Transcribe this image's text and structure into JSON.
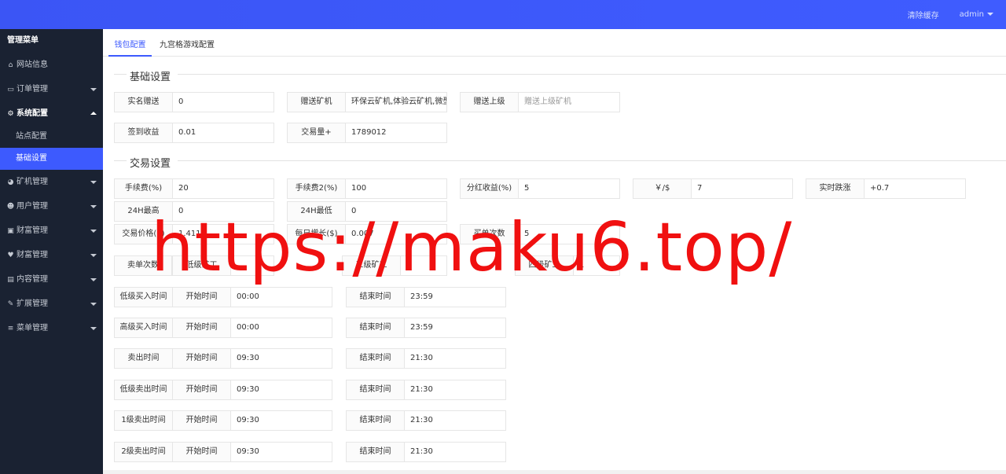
{
  "topbar": {
    "clear_cache": "清除缓存",
    "user": "admin"
  },
  "sidebar": {
    "title": "管理菜单",
    "items": [
      {
        "label": "网站信息",
        "icon": "home-icon"
      },
      {
        "label": "订单管理",
        "icon": "card-icon"
      },
      {
        "label": "系统配置",
        "icon": "gears-icon"
      },
      {
        "label": "矿机管理",
        "icon": "pie-icon"
      },
      {
        "label": "用户管理",
        "icon": "users-icon"
      },
      {
        "label": "财富管理",
        "icon": "money-icon"
      },
      {
        "label": "财富管理",
        "icon": "heartbeat-icon"
      },
      {
        "label": "内容管理",
        "icon": "file-icon"
      },
      {
        "label": "扩展管理",
        "icon": "wrench-icon"
      },
      {
        "label": "菜单管理",
        "icon": "bars-icon"
      }
    ],
    "sub_items": [
      "站点配置",
      "基础设置"
    ]
  },
  "tabs": [
    "钱包配置",
    "九宫格游戏配置"
  ],
  "sections": {
    "basic": "基础设置",
    "trade": "交易设置"
  },
  "basic": {
    "real_name_gift": {
      "label": "实名赠送",
      "value": "0"
    },
    "gift_miner": {
      "label": "赠送矿机",
      "value": "环保云矿机,体验云矿机,微型云矿机"
    },
    "gift_superior": {
      "label": "赠送上级",
      "placeholder": "赠送上级矿机"
    },
    "signin_income": {
      "label": "签到收益",
      "value": "0.01"
    },
    "trade_volume": {
      "label": "交易量+",
      "value": "1789012"
    }
  },
  "trade": {
    "fee": {
      "label": "手续费(%)",
      "value": "20"
    },
    "fee2": {
      "label": "手续费2(%)",
      "value": "100"
    },
    "dividend": {
      "label": "分红收益(%)",
      "value": "5"
    },
    "rate": {
      "label": "￥/$",
      "value": "7"
    },
    "realtime": {
      "label": "实时跌涨",
      "value": "+0.7"
    },
    "high24": {
      "label": "24H最高",
      "value": "0"
    },
    "low24": {
      "label": "24H最低",
      "value": "0"
    },
    "price": {
      "label": "交易价格($)",
      "value": "1.411"
    },
    "daily_growth": {
      "label": "每日增长($)",
      "value": "0.007"
    },
    "buy_times": {
      "label": "买单次数",
      "value": "5"
    },
    "sell_times": {
      "label": "卖单次数",
      "value": ""
    },
    "low_worker": {
      "label": "低级矿工",
      "value": ""
    },
    "third_worker": {
      "label": "三级矿工",
      "value": ""
    },
    "fourth_worker": {
      "label": "四级矿工",
      "value": "1"
    }
  },
  "time_rows": [
    {
      "label": "低级买入时间",
      "start_label": "开始时间",
      "start": "00:00",
      "end_label": "结束时间",
      "end": "23:59"
    },
    {
      "label": "高级买入时间",
      "start_label": "开始时间",
      "start": "00:00",
      "end_label": "结束时间",
      "end": "23:59"
    },
    {
      "label": "卖出时间",
      "start_label": "开始时间",
      "start": "09:30",
      "end_label": "结束时间",
      "end": "21:30"
    },
    {
      "label": "低级卖出时间",
      "start_label": "开始时间",
      "start": "09:30",
      "end_label": "结束时间",
      "end": "21:30"
    },
    {
      "label": "1级卖出时间",
      "start_label": "开始时间",
      "start": "09:30",
      "end_label": "结束时间",
      "end": "21:30"
    },
    {
      "label": "2级卖出时间",
      "start_label": "开始时间",
      "start": "09:30",
      "end_label": "结束时间",
      "end": "21:30"
    }
  ],
  "watermark": "https://maku6.top/",
  "colors": {
    "accent": "#3d5afe",
    "sidebar": "#1a2232",
    "watermark": "#f01010"
  }
}
